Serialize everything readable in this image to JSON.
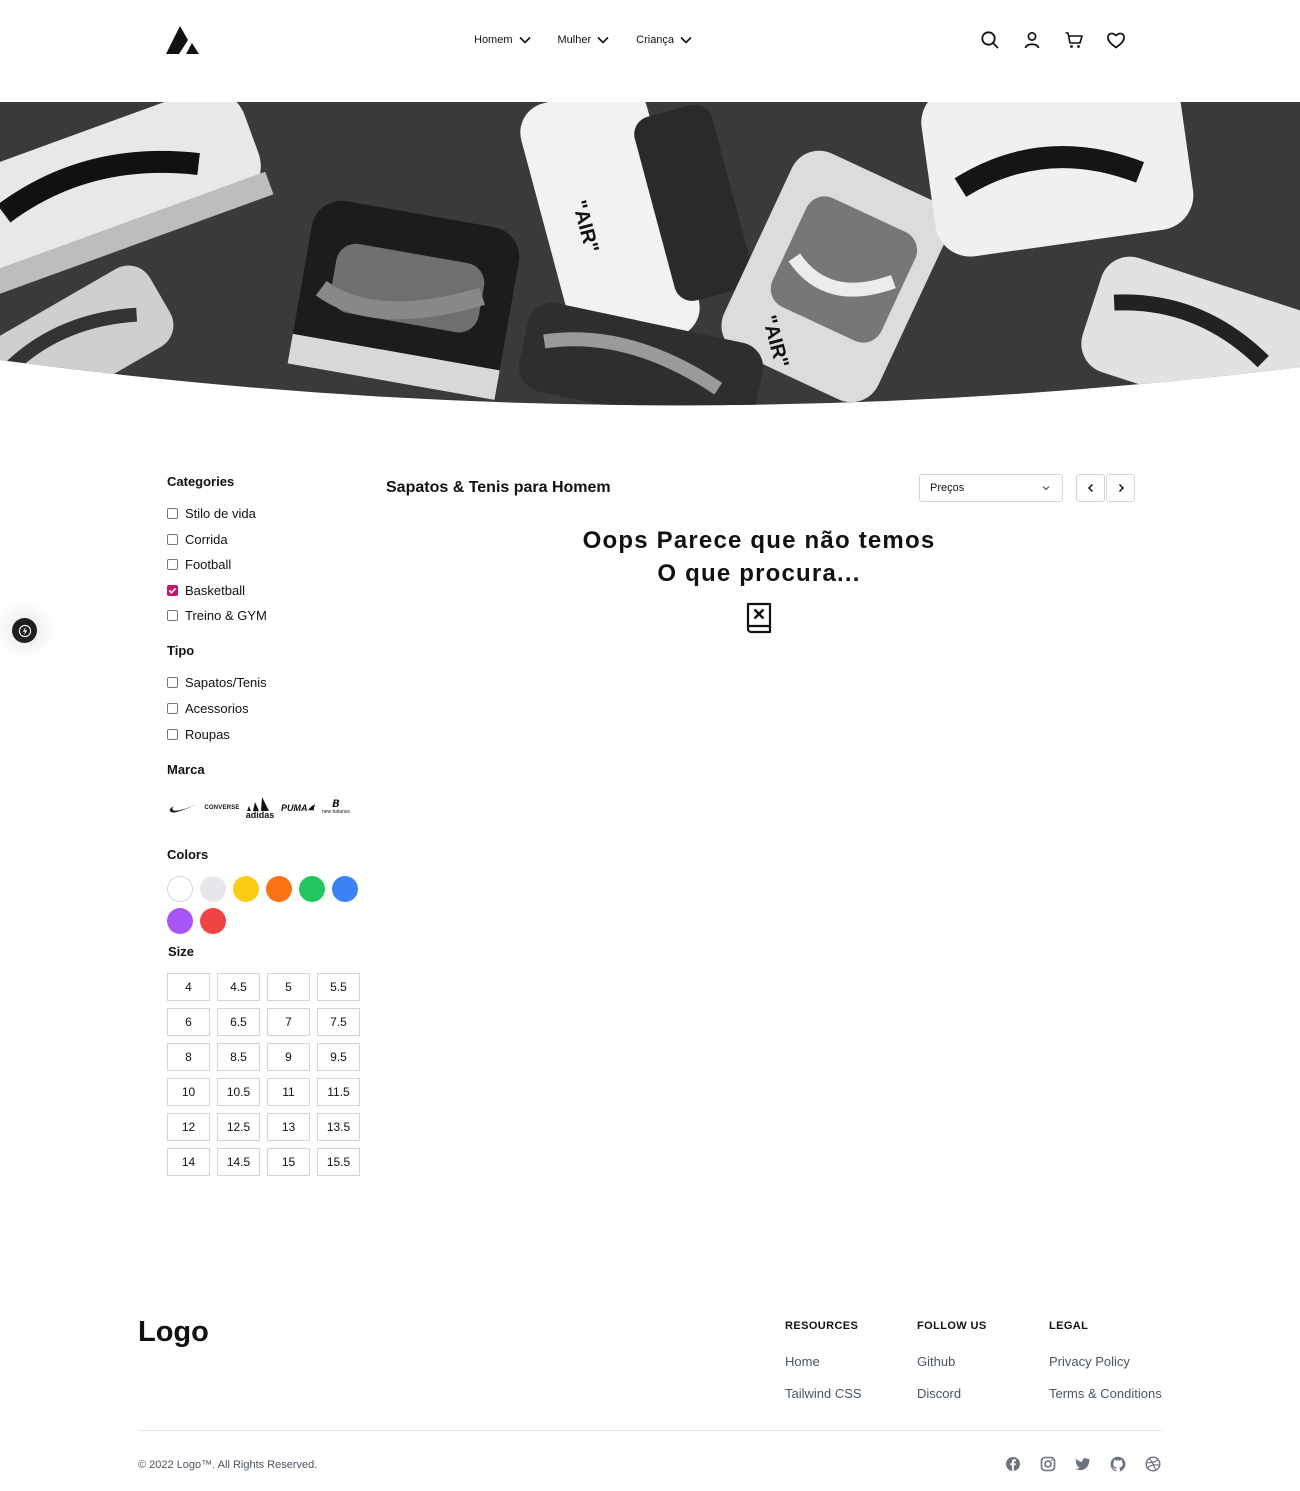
{
  "header": {
    "nav": [
      {
        "label": "Homem"
      },
      {
        "label": "Mulher"
      },
      {
        "label": "Criança"
      }
    ],
    "icons": [
      "search-icon",
      "user-icon",
      "cart-icon",
      "heart-icon"
    ]
  },
  "hero": {
    "image": "grayscale-sneakers-pile",
    "shoe_texts": [
      "\"AIR\"",
      "\"AIR\""
    ]
  },
  "filters": {
    "categories_title": "Categories",
    "categories": [
      {
        "label": "Stilo de vida",
        "checked": false
      },
      {
        "label": "Corrida",
        "checked": false
      },
      {
        "label": "Football",
        "checked": false
      },
      {
        "label": "Basketball",
        "checked": true
      },
      {
        "label": "Treino & GYM",
        "checked": false
      }
    ],
    "type_title": "Tipo",
    "types": [
      {
        "label": "Sapatos/Tenis",
        "checked": false
      },
      {
        "label": "Acessorios",
        "checked": false
      },
      {
        "label": "Roupas",
        "checked": false
      }
    ],
    "brand_title": "Marca",
    "brands": [
      {
        "name": "nike-logo"
      },
      {
        "name": "converse-logo",
        "text": "CONVERSE"
      },
      {
        "name": "adidas-logo",
        "text": "adidas"
      },
      {
        "name": "puma-logo",
        "text": "PUMA"
      },
      {
        "name": "new-balance-logo",
        "text": "new balance"
      }
    ],
    "colors_title": "Colors",
    "colors": [
      "#ffffff",
      "#e5e7eb",
      "#facc15",
      "#f97316",
      "#22c55e",
      "#3b82f6",
      "#a855f7",
      "#ef4444"
    ],
    "size_title": "Size",
    "sizes": [
      "4",
      "4.5",
      "5",
      "5.5",
      "6",
      "6.5",
      "7",
      "7.5",
      "8",
      "8.5",
      "9",
      "9.5",
      "10",
      "10.5",
      "11",
      "11.5",
      "12",
      "12.5",
      "13",
      "13.5",
      "14",
      "14.5",
      "15",
      "15.5"
    ]
  },
  "main": {
    "title": "Sapatos & Tenis para Homem",
    "sort_value": "Preços",
    "empty_line1": "Oops Parece que não temos",
    "empty_line2": "O que procura...",
    "empty_icon": "book-x-icon"
  },
  "footer": {
    "logo": "Logo",
    "columns": [
      {
        "heading": "RESOURCES",
        "links": [
          "Home",
          "Tailwind CSS"
        ]
      },
      {
        "heading": "FOLLOW US",
        "links": [
          "Github",
          "Discord"
        ]
      },
      {
        "heading": "LEGAL",
        "links": [
          "Privacy Policy",
          "Terms & Conditions"
        ]
      }
    ],
    "copyright": "© 2022 Logo™. All Rights Reserved.",
    "socials": [
      "facebook-icon",
      "instagram-icon",
      "twitter-icon",
      "github-icon",
      "dribbble-icon"
    ]
  }
}
